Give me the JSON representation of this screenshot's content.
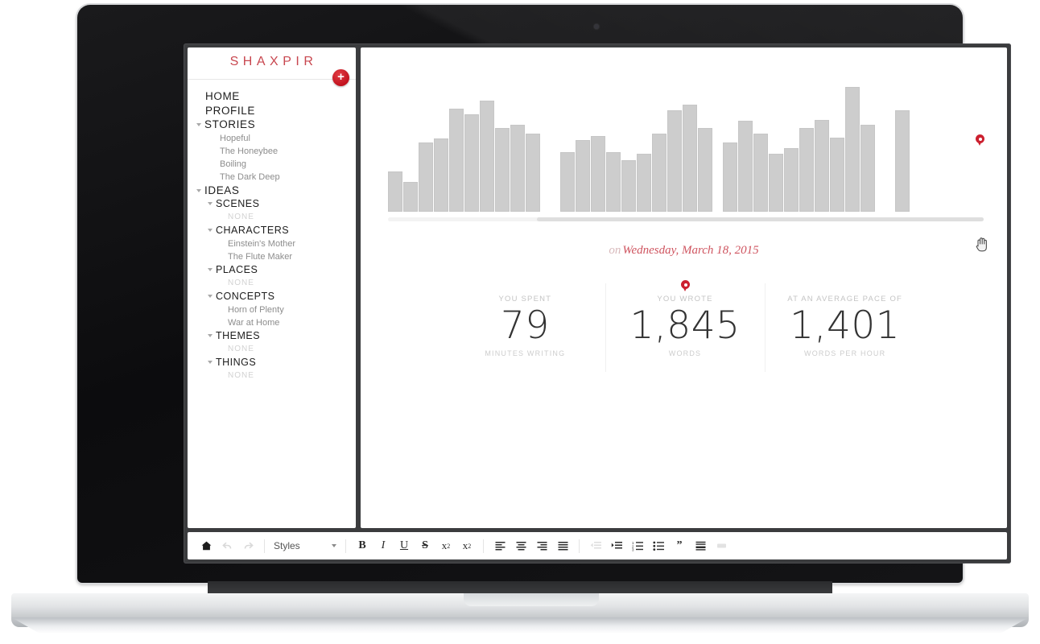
{
  "app": {
    "brand": "SHAXPIR",
    "add_button_label": "+"
  },
  "sidebar": {
    "items": [
      {
        "label": "HOME",
        "level": "top",
        "caret": false
      },
      {
        "label": "PROFILE",
        "level": "top",
        "caret": false
      },
      {
        "label": "STORIES",
        "level": "top",
        "caret": true
      },
      {
        "label": "Hopeful",
        "level": "leaf"
      },
      {
        "label": "The Honeybee",
        "level": "leaf"
      },
      {
        "label": "Boiling",
        "level": "leaf"
      },
      {
        "label": "The Dark Deep",
        "level": "leaf"
      },
      {
        "label": "IDEAS",
        "level": "top",
        "caret": true
      },
      {
        "label": "SCENES",
        "level": "group",
        "caret": true
      },
      {
        "label": "NONE",
        "level": "none"
      },
      {
        "label": "CHARACTERS",
        "level": "group",
        "caret": true
      },
      {
        "label": "Einstein's Mother",
        "level": "leaf"
      },
      {
        "label": "The Flute Maker",
        "level": "leaf"
      },
      {
        "label": "PLACES",
        "level": "group",
        "caret": true
      },
      {
        "label": "NONE",
        "level": "none"
      },
      {
        "label": "CONCEPTS",
        "level": "group",
        "caret": true
      },
      {
        "label": "Horn of Plenty",
        "level": "leaf"
      },
      {
        "label": "War at Home",
        "level": "leaf"
      },
      {
        "label": "THEMES",
        "level": "group",
        "caret": true
      },
      {
        "label": "NONE",
        "level": "none"
      },
      {
        "label": "THINGS",
        "level": "group",
        "caret": true
      },
      {
        "label": "NONE",
        "level": "none"
      }
    ]
  },
  "main": {
    "date_prefix": "on",
    "date_value": "Wednesday, March 18, 2015",
    "stats": [
      {
        "label": "YOU SPENT",
        "value": "79",
        "sub": "MINUTES WRITING",
        "pin": false
      },
      {
        "label": "YOU WROTE",
        "value": "1,845",
        "sub": "WORDS",
        "pin": true
      },
      {
        "label": "AT AN AVERAGE PACE OF",
        "value": "1,401",
        "sub": "WORDS PER HOUR",
        "pin": false
      }
    ]
  },
  "chart_data": {
    "type": "bar",
    "title": "",
    "xlabel": "",
    "ylabel": "",
    "grid": false,
    "legend": false,
    "selected_index": 37,
    "selected_color": "#cc202f",
    "bar_color": "#cdcdcd",
    "ylim": [
      0,
      100
    ],
    "categories": [
      "b1",
      "b2",
      "b3",
      "b4",
      "b5",
      "b6",
      "b7",
      "b8",
      "b9",
      "b10",
      "b11",
      "gap1",
      "b12",
      "b13",
      "b14",
      "b15",
      "b16",
      "b17",
      "b18",
      "b19",
      "b20",
      "b21",
      "gap2",
      "b22",
      "b23",
      "b24",
      "b25",
      "b26",
      "b27",
      "b28",
      "b29",
      "b30",
      "b31",
      "b32",
      "b33",
      "selected"
    ],
    "values": [
      30,
      22,
      51,
      54,
      76,
      72,
      82,
      62,
      64,
      58,
      0,
      0,
      44,
      53,
      56,
      44,
      38,
      43,
      58,
      75,
      79,
      62,
      0,
      51,
      67,
      58,
      43,
      47,
      62,
      68,
      55,
      92,
      64,
      0,
      0,
      75
    ],
    "scrollbar": {
      "visible": true,
      "thumb_start_pct": 25,
      "thumb_width_pct": 75
    }
  },
  "toolbar": {
    "items": [
      {
        "name": "home-icon",
        "glyph": "⌂",
        "type": "icon",
        "disabled": false
      },
      {
        "name": "undo-icon",
        "glyph": "←",
        "type": "icon",
        "disabled": true
      },
      {
        "name": "redo-icon",
        "glyph": "→",
        "type": "icon",
        "disabled": true
      }
    ],
    "styles_label": "Styles",
    "format_buttons": [
      {
        "name": "bold-button",
        "glyph": "B",
        "cls": "fmt-b"
      },
      {
        "name": "italic-button",
        "glyph": "I",
        "cls": "fmt-i"
      },
      {
        "name": "underline-button",
        "glyph": "U",
        "cls": "fmt-u"
      },
      {
        "name": "strikethrough-button",
        "glyph": "S",
        "cls": "fmt-s"
      }
    ],
    "subscript_label": "x",
    "subscript_mark": "2",
    "superscript_label": "x",
    "superscript_mark": "2",
    "align_buttons": [
      {
        "name": "align-left-button"
      },
      {
        "name": "align-center-button"
      },
      {
        "name": "align-right-button"
      },
      {
        "name": "align-justify-button"
      }
    ],
    "list_buttons": [
      {
        "name": "outdent-button",
        "disabled": true
      },
      {
        "name": "indent-button",
        "disabled": false
      },
      {
        "name": "numbered-list-button",
        "disabled": false
      },
      {
        "name": "bulleted-list-button",
        "disabled": false
      }
    ],
    "blockquote_glyph": "”",
    "horizontal-rule": "hr",
    "last_disabled": true
  }
}
